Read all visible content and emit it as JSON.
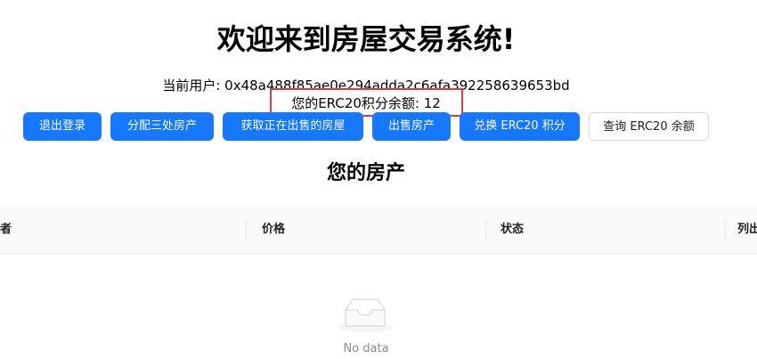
{
  "header": {
    "title": "欢迎来到房屋交易系统!",
    "current_user": "当前用户: 0x48a488f85ae0e294adda2c6afa392258639653bd",
    "erc20_balance": "您的ERC20积分余额: 12"
  },
  "toolbar": {
    "logout_label": "退出登录",
    "allocate_label": "分配三处房产",
    "get_on_sale_label": "获取正在出售的房屋",
    "sell_label": "出售房产",
    "exchange_label": "兑换 ERC20 积分",
    "query_label": "查询 ERC20 余额"
  },
  "properties": {
    "title": "您的房产",
    "columns": [
      "者",
      "价格",
      "状态",
      "列出"
    ],
    "empty_text": "No data"
  },
  "colors": {
    "primary": "#1677ff",
    "highlight": "#e53935",
    "header_bg": "#fafafa"
  },
  "icons": {
    "empty": "empty-inbox-icon"
  }
}
